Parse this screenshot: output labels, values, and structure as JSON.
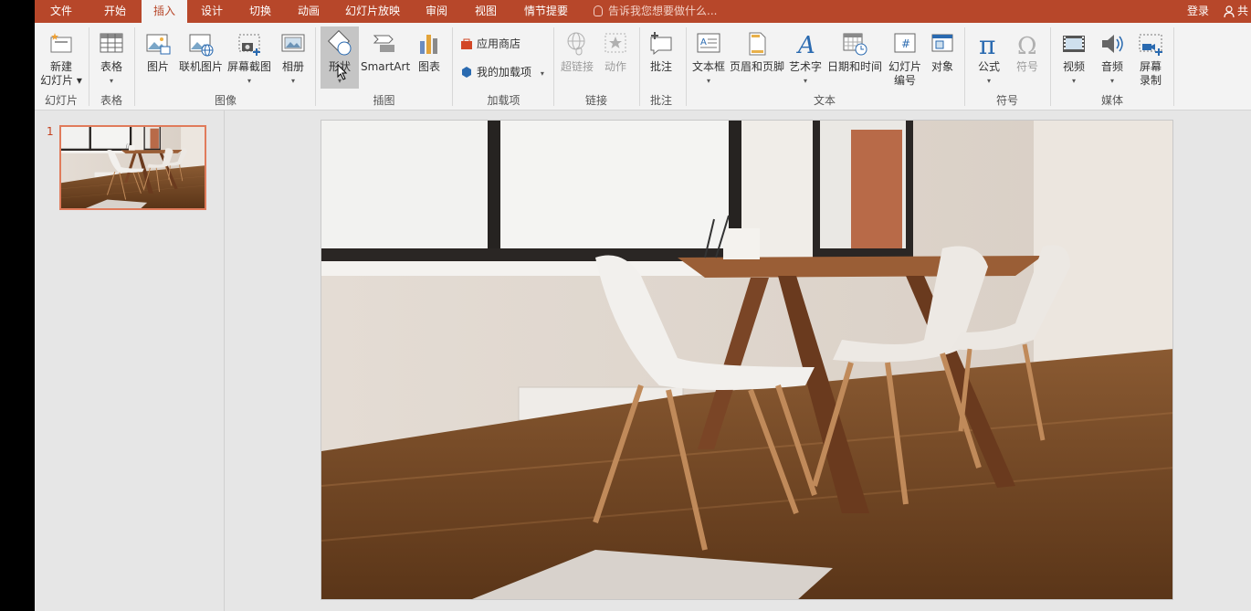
{
  "tabs": [
    "文件",
    "开始",
    "插入",
    "设计",
    "切换",
    "动画",
    "幻灯片放映",
    "审阅",
    "视图",
    "情节提要"
  ],
  "active_tab": "插入",
  "tell_me": "告诉我您想要做什么...",
  "signin": "登录",
  "share": "共",
  "ribbon": {
    "new_slide": {
      "line1": "新建",
      "line2": "幻灯片"
    },
    "table": "表格",
    "picture": "图片",
    "online_picture": "联机图片",
    "screenshot": "屏幕截图",
    "album": "相册",
    "shapes": "形状",
    "smartart": "SmartArt",
    "chart": "图表",
    "app_store": "应用商店",
    "my_addins": "我的加载项",
    "hyperlink": "超链接",
    "action": "动作",
    "comment": "批注",
    "textbox": "文本框",
    "header_footer": "页眉和页脚",
    "wordart": "艺术字",
    "datetime": "日期和时间",
    "slide_number": {
      "line1": "幻灯片",
      "line2": "编号"
    },
    "object": "对象",
    "equation": "公式",
    "symbol": "符号",
    "video": "视频",
    "audio": "音频",
    "screen_record": {
      "line1": "屏幕",
      "line2": "录制"
    }
  },
  "groups": {
    "slides": "幻灯片",
    "tables": "表格",
    "images": "图像",
    "illustrations": "插图",
    "addins": "加载项",
    "links": "链接",
    "comments": "批注",
    "text": "文本",
    "symbols": "符号",
    "media": "媒体"
  },
  "slide_panel": {
    "number": "1"
  },
  "colors": {
    "accent": "#b7472a",
    "ribbon_bg": "#f3f3f3",
    "thumb_border": "#e07b5b"
  }
}
